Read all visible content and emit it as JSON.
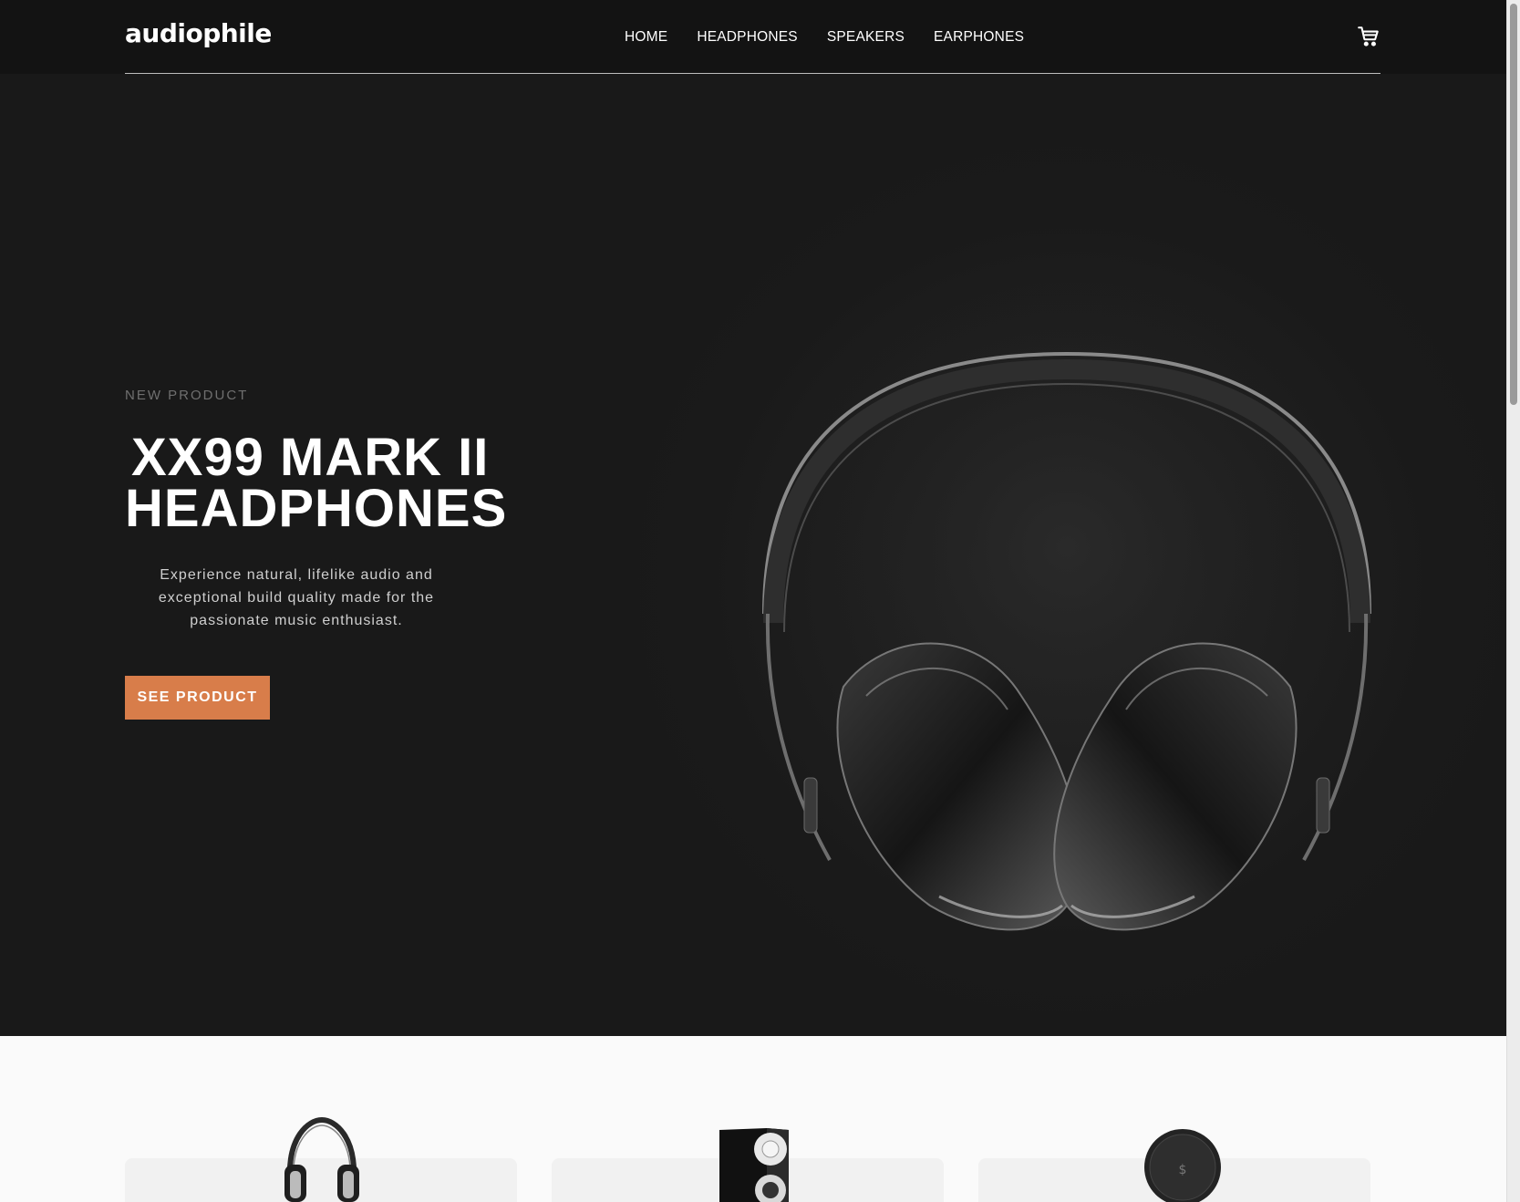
{
  "header": {
    "logo": "audiophile",
    "nav": [
      "HOME",
      "HEADPHONES",
      "SPEAKERS",
      "EARPHONES"
    ],
    "cart_icon": "cart-icon"
  },
  "hero": {
    "eyebrow": "NEW PRODUCT",
    "title_line1": "XX99 MARK II",
    "title_line2": "HEADPHONES",
    "description": "Experience natural, lifelike audio and exceptional build quality made for the passionate music enthusiast.",
    "cta": "SEE PRODUCT",
    "image_icon": "headphones-icon"
  },
  "categories": {
    "images": [
      "headphones-icon",
      "speaker-icon",
      "earphones-icon"
    ]
  },
  "colors": {
    "accent": "#d87d4a",
    "header_bg": "#131313",
    "hero_bg": "#191919",
    "page_bg": "#fafafa",
    "card_bg": "#f1f1f1"
  }
}
